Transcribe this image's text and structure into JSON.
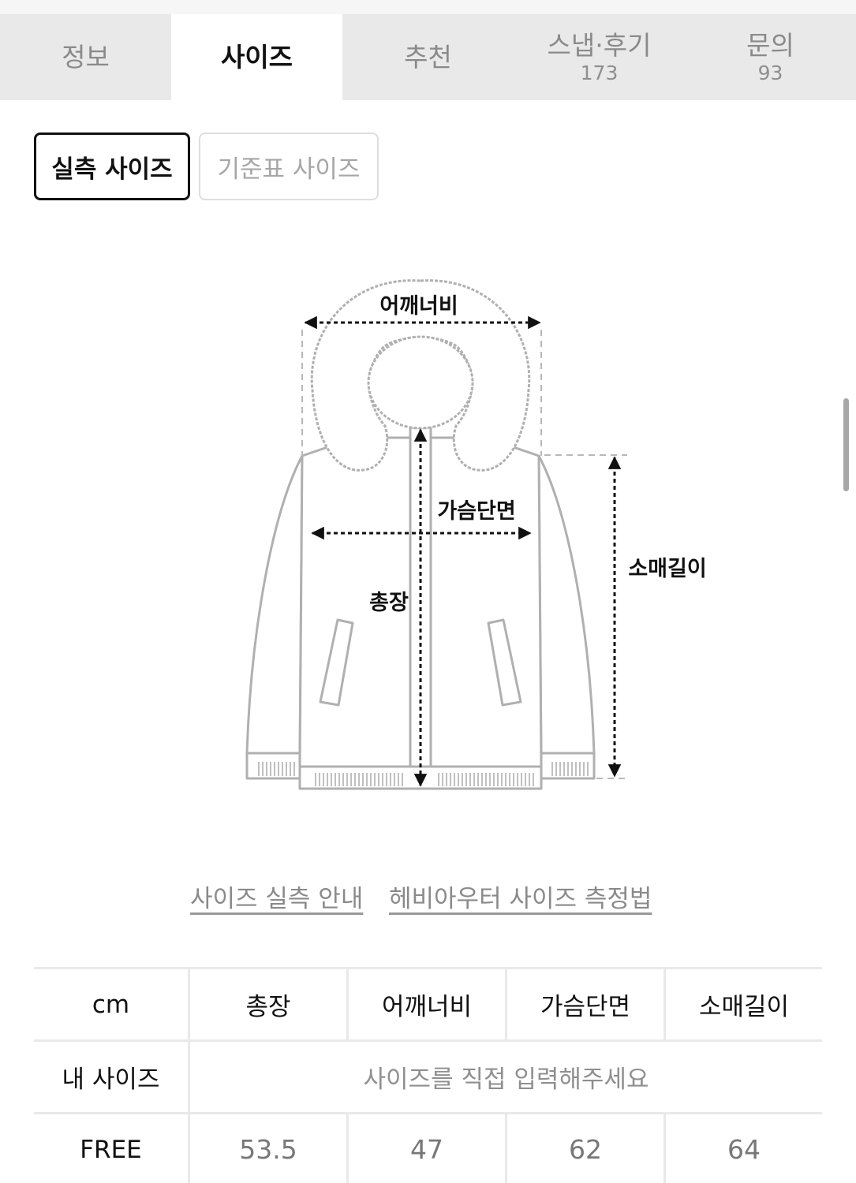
{
  "tabs": [
    {
      "label": "정보",
      "count": ""
    },
    {
      "label": "사이즈",
      "count": ""
    },
    {
      "label": "추천",
      "count": ""
    },
    {
      "label": "스냅·후기",
      "count": "173"
    },
    {
      "label": "문의",
      "count": "93"
    }
  ],
  "active_tab": "사이즈",
  "size_toggle": {
    "measured": "실측 사이즈",
    "standard": "기준표 사이즈"
  },
  "diagram": {
    "shoulder": "어깨너비",
    "chest": "가슴단면",
    "length": "총장",
    "sleeve": "소매길이"
  },
  "links": {
    "guide": "사이즈 실측 안내",
    "method": "헤비아우터 사이즈 측정법"
  },
  "table": {
    "unit": "cm",
    "columns": [
      "총장",
      "어깨너비",
      "가슴단면",
      "소매길이"
    ],
    "my_size_label": "내 사이즈",
    "my_size_prompt": "사이즈를 직접 입력해주세요",
    "rows": [
      {
        "size": "FREE",
        "values": [
          "53.5",
          "47",
          "62",
          "64"
        ]
      }
    ]
  }
}
